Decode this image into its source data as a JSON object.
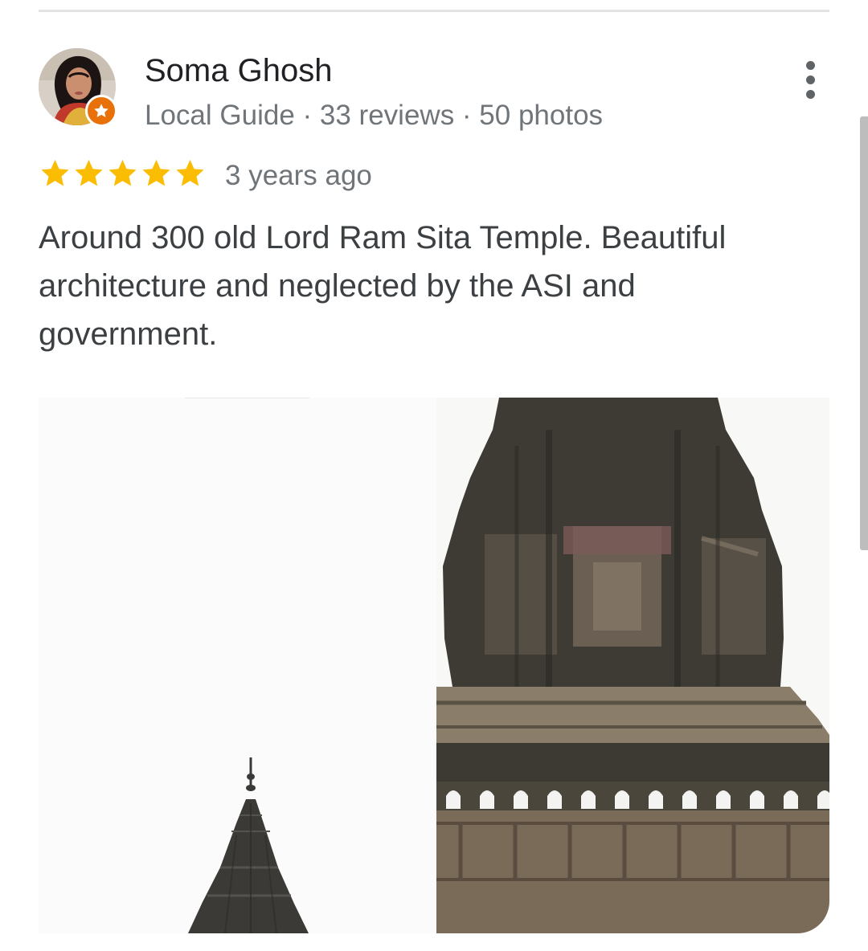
{
  "review": {
    "author": {
      "name": "Soma Ghosh",
      "meta": "Local Guide · 33 reviews · 50 photos",
      "avatar_icon": "user-avatar-photo",
      "badge_icon": "local-guide-star-badge",
      "badge_color": "#e8710a"
    },
    "menu_icon": "more-vert-icon",
    "rating": 5,
    "rating_max": 5,
    "star_color": "#fbbc04",
    "time": "3 years ago",
    "text": "Around 300 old Lord Ram Sita Temple. Beautiful architecture and neglected by the ASI and government.",
    "photos": [
      {
        "subject": "temple-spire-photo"
      },
      {
        "subject": "temple-tower-closeup-photo"
      }
    ]
  }
}
